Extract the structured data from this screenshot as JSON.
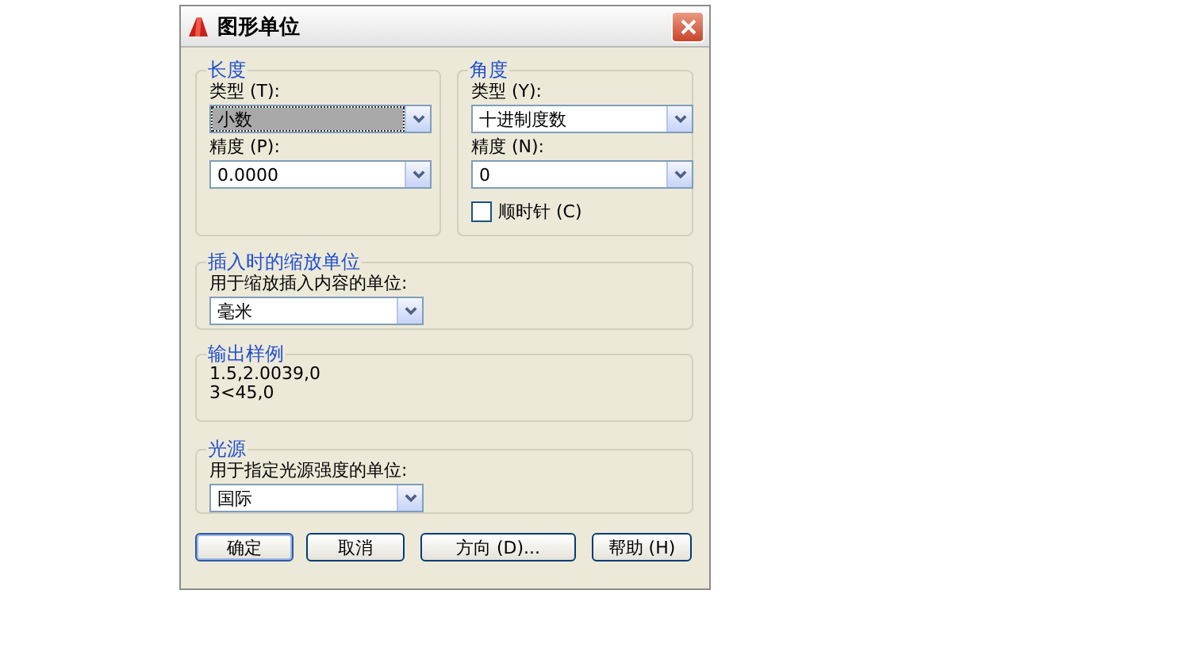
{
  "window": {
    "title": "图形单位"
  },
  "length": {
    "title": "长度",
    "fields": [
      {
        "label": "类型 (T):",
        "value": "小数",
        "focused": true
      },
      {
        "label": "精度 (P):",
        "value": "0.0000",
        "focused": false
      }
    ]
  },
  "angle": {
    "title": "角度",
    "fields": [
      {
        "label": "类型 (Y):",
        "value": "十进制度数",
        "focused": false
      },
      {
        "label": "精度 (N):",
        "value": "0",
        "focused": false
      }
    ],
    "clockwise": {
      "label": "顺时针 (C)",
      "checked": false
    }
  },
  "insertion_scale": {
    "title": "插入时的缩放单位",
    "label": "用于缩放插入内容的单位:",
    "value": "毫米"
  },
  "sample_output": {
    "title": "输出样例",
    "lines": [
      "1.5,2.0039,0",
      "3<45,0"
    ]
  },
  "lighting": {
    "title": "光源",
    "label": "用于指定光源强度的单位:",
    "value": "国际"
  },
  "buttons": [
    {
      "label": "确定",
      "default": true
    },
    {
      "label": "取消",
      "default": false
    },
    {
      "label": "方向 (D)...",
      "default": false
    },
    {
      "label": "帮助 (H)",
      "default": false
    }
  ]
}
